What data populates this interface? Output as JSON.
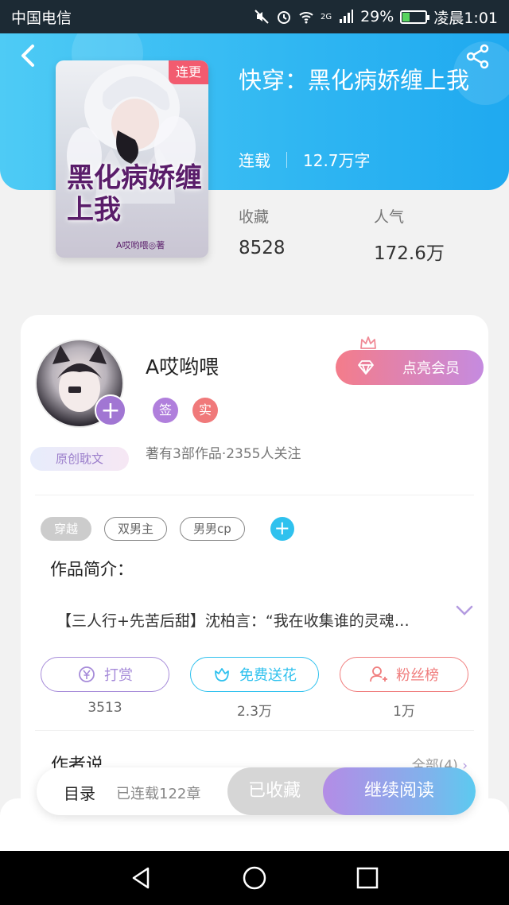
{
  "status_bar": {
    "carrier": "中国电信",
    "network": "2G",
    "battery": "29%",
    "time": "凌晨1:01",
    "battery_level": 0.29
  },
  "book": {
    "badge": "连更",
    "cover_title": "黑化病娇缠上我",
    "cover_author": "A哎哟喂◎著",
    "title": "快穿：黑化病娇缠上我",
    "status": "连载",
    "word_count": "12.7万字",
    "stats": [
      {
        "label": "收藏",
        "value": "8528"
      },
      {
        "label": "人气",
        "value": "172.6万"
      }
    ]
  },
  "author": {
    "name": "A哎哟喂",
    "badge_sign": "签",
    "badge_real": "实",
    "info": "著有3部作品·2355人关注",
    "original_tag": "原创耽文",
    "vip_button": "点亮会员"
  },
  "tags": [
    "穿越",
    "双男主",
    "男男cp"
  ],
  "intro": {
    "label": "作品简介：",
    "text": "【三人行+先苦后甜】沈柏言：“我在收集谁的灵魂…"
  },
  "actions": [
    {
      "label": "打赏",
      "count": "3513",
      "color": "#a68bd9",
      "icon": "coin-icon"
    },
    {
      "label": "免费送花",
      "count": "2.3万",
      "color": "#2fc1ee",
      "icon": "flower-icon"
    },
    {
      "label": "粉丝榜",
      "count": "1万",
      "color": "#f07d7d",
      "icon": "user-rank-icon"
    }
  ],
  "author_say": {
    "label": "作者说",
    "all_link": "全部(4)"
  },
  "bottom_bar": {
    "toc": "目录",
    "chapters": "已连载122章",
    "collected": "已收藏",
    "continue": "继续阅读"
  },
  "colors": {
    "header": "#2fb6f2",
    "accent_purple": "#a176d3",
    "vip_pink": "#f47c8a"
  }
}
